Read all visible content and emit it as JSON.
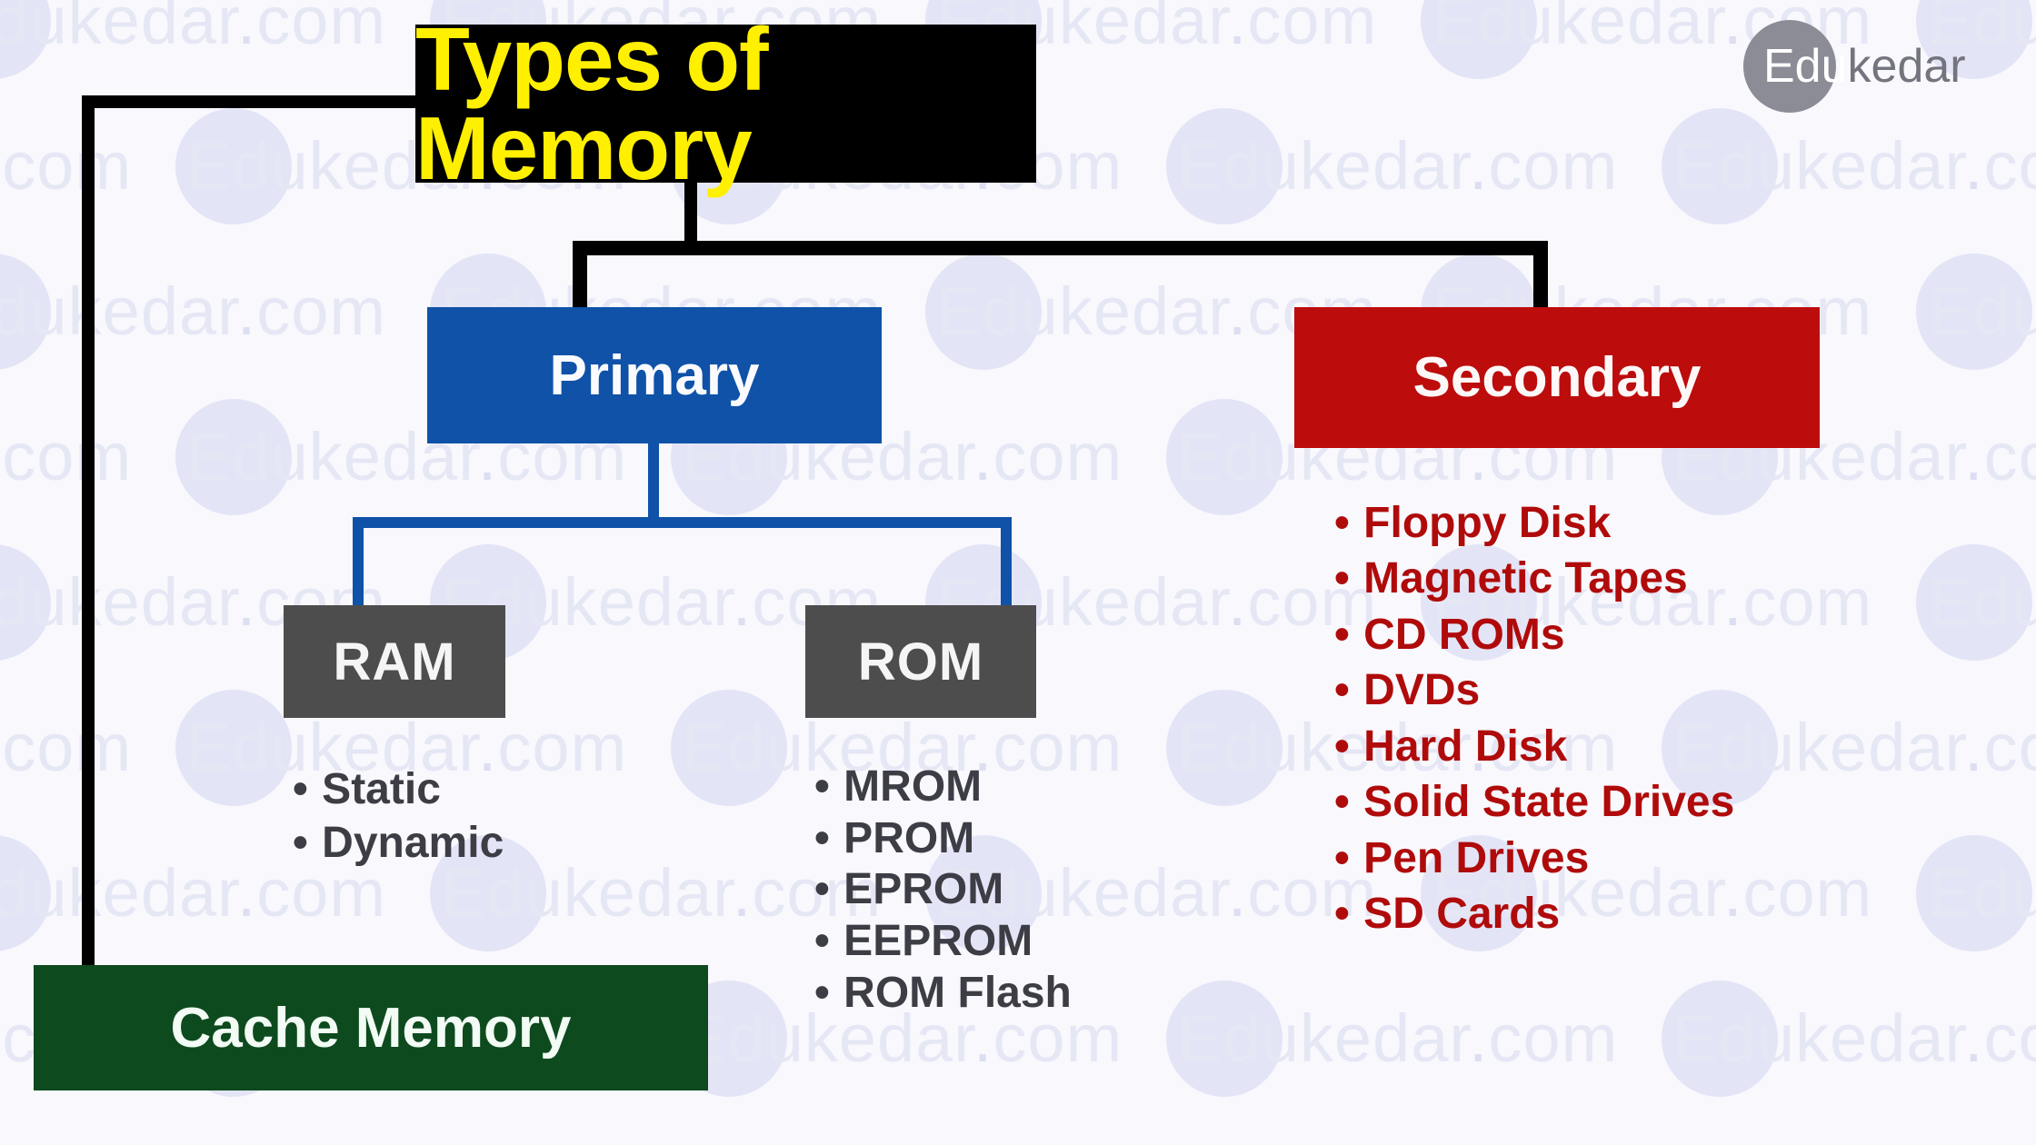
{
  "diagram": {
    "title": "Types of Memory",
    "branches": {
      "primary": {
        "label": "Primary",
        "children": [
          {
            "label": "RAM",
            "items": [
              "Static",
              "Dynamic"
            ]
          },
          {
            "label": "ROM",
            "items": [
              "MROM",
              "PROM",
              "EPROM",
              "EEPROM",
              "ROM Flash"
            ]
          }
        ]
      },
      "secondary": {
        "label": "Secondary",
        "items": [
          "Floppy Disk",
          "Magnetic Tapes",
          "CD ROMs",
          "DVDs",
          "Hard Disk",
          "Solid State Drives",
          "Pen Drives",
          "SD Cards"
        ]
      },
      "cache": {
        "label": "Cache Memory"
      }
    },
    "bullet_glyph": "•"
  },
  "logo": {
    "primary_text": "Edu",
    "secondary_text": "kedar"
  },
  "watermark": {
    "text_primary": "Edu",
    "text_secondary": "kedar",
    "dot": ".",
    "text_tld": "com"
  },
  "colors": {
    "background": "#f8f8fd",
    "title_box": "#000000",
    "title_text": "#ffef00",
    "primary_box": "#0f52a8",
    "secondary_box": "#bd0c0c",
    "chip_box": "#4d4d4d",
    "cache_box": "#0d4a1e",
    "secondary_list_text": "#b00b0b",
    "sub_list_text": "#3d3d45",
    "connector_black": "#000000",
    "connector_blue": "#0f52a8",
    "logo_circle": "#8b8c96",
    "logo_text": "#73747e",
    "watermark": "#edeef8"
  }
}
